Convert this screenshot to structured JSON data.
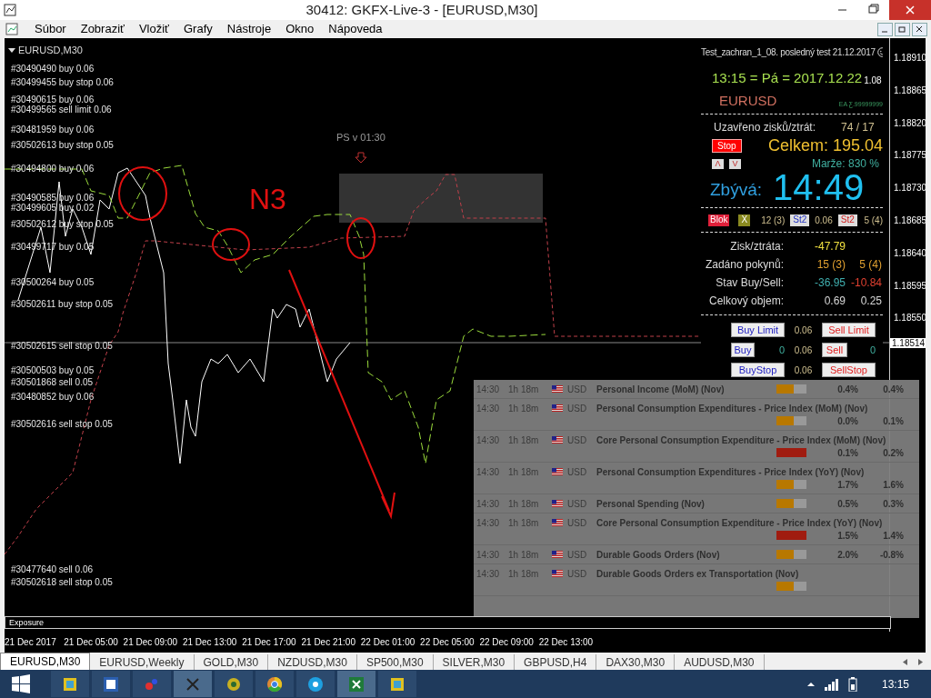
{
  "window": {
    "title": "30412: GKFX-Live-3 - [EURUSD,M30]"
  },
  "menu": [
    "Súbor",
    "Zobraziť",
    "Vložiť",
    "Grafy",
    "Nástroje",
    "Okno",
    "Nápoveda"
  ],
  "chart": {
    "symbol": "EURUSD,M30",
    "annotation": "N3",
    "event_label": "PS v 01:30",
    "order_labels": [
      "#30490490 buy 0.06",
      "#30499455 buy stop 0.06",
      "#30490615 buy 0.06",
      "#30499565 sell limit 0.06",
      "#30481959 buy 0.06",
      "#30502613 buy stop 0.05",
      "#30494800 buy 0.06",
      "#30490585 buy 0.06",
      "#30499605 buy 0.02",
      "#30502612 buy stop 0.05",
      "#30499717 buy 0.05",
      "#30500264 buy 0.05",
      "#30502611 buy stop 0.05",
      "#30502615 sell stop 0.05",
      "#30500503 buy 0.05",
      "#30501868 sell 0.05",
      "#30480852 buy 0.06",
      "#30502616 sell stop 0.05",
      "#30477640 sell 0.06",
      "#30502618 sell stop 0.05"
    ],
    "price_axis": [
      "1.18910",
      "1.18865",
      "1.18820",
      "1.18775",
      "1.18730",
      "1.18685",
      "1.18640",
      "1.18595",
      "1.18550"
    ],
    "current_price": "1.18514",
    "exposure_label": "Exposure"
  },
  "time_axis": [
    "21 Dec 2017",
    "21 Dec 05:00",
    "21 Dec 09:00",
    "21 Dec 13:00",
    "21 Dec 17:00",
    "21 Dec 21:00",
    "22 Dec 01:00",
    "22 Dec 05:00",
    "22 Dec 09:00",
    "22 Dec 13:00"
  ],
  "panel": {
    "title": "Test_zachran_1_08. posledný test 21.12.2017",
    "clock": "13:15 = Pá = 2017.12.22",
    "clock_suffix": "1.08",
    "symbol": "EURUSD",
    "ea_tag": "EA Ƹ.99999999",
    "closed_label": "Uzavřeno zisků/ztrát:",
    "closed_value": "74 / 17",
    "stop_button": "Stop",
    "total": "Celkem: 195.04",
    "arrow_buttons": [
      "Λ",
      "V"
    ],
    "margin": "Marže: 830 %",
    "remaining_label": "Zbývá:",
    "remaining": "14:49",
    "blok_button": "Blok",
    "x_button": "X",
    "buy_count": "12 (3)",
    "st2_buy_button": "St2",
    "lot": "0.06",
    "st2_sell_button": "St2",
    "sell_count": "5 (4)",
    "stats": [
      {
        "label": "Zisk/ztráta:",
        "values": [
          {
            "text": "-47.79",
            "color": "#f0e040"
          }
        ]
      },
      {
        "label": "Zadáno pokynů:",
        "values": [
          {
            "text": "15 (3)",
            "color": "#e0a030"
          },
          {
            "text": "5 (4)",
            "color": "#e0a030"
          }
        ]
      },
      {
        "label": "Stav Buy/Sell:",
        "values": [
          {
            "text": "-36.95",
            "color": "#40b0b0"
          },
          {
            "text": "-10.84",
            "color": "#e04030"
          }
        ]
      },
      {
        "label": "Celkový objem:",
        "values": [
          {
            "text": "0.69",
            "color": "#d8d8d8"
          },
          {
            "text": "0.25",
            "color": "#d8d8d8"
          }
        ]
      }
    ],
    "order_rows": [
      {
        "buy": "Buy Limit",
        "lot": "0.06",
        "sell": "Sell Limit"
      },
      {
        "buy": "Buy",
        "buy_count": "0",
        "lot": "0.06",
        "sell": "Sell",
        "sell_count": "0"
      },
      {
        "buy": "BuyStop",
        "lot": "0.06",
        "sell": "SellStop"
      }
    ]
  },
  "news": [
    {
      "time": "14:30",
      "countdown": "1h 18m",
      "currency": "USD",
      "event": "Personal Income (MoM) (Nov)",
      "level": 0.58,
      "color": "#b87800",
      "forecast": "0.4%",
      "previous": "0.4%"
    },
    {
      "time": "14:30",
      "countdown": "1h 18m",
      "currency": "USD",
      "event": "Personal Consumption Expenditures - Price Index (MoM) (Nov)",
      "level": 0.58,
      "color": "#b87800",
      "forecast": "0.0%",
      "previous": "0.1%"
    },
    {
      "time": "14:30",
      "countdown": "1h 18m",
      "currency": "USD",
      "event": "Core Personal Consumption Expenditure - Price Index (MoM) (Nov)",
      "level": 1,
      "color": "#a01c10",
      "forecast": "0.1%",
      "previous": "0.2%"
    },
    {
      "time": "14:30",
      "countdown": "1h 18m",
      "currency": "USD",
      "event": "Personal Consumption Expenditures - Price Index (YoY) (Nov)",
      "level": 0.58,
      "color": "#b87800",
      "forecast": "1.7%",
      "previous": "1.6%"
    },
    {
      "time": "14:30",
      "countdown": "1h 18m",
      "currency": "USD",
      "event": "Personal Spending (Nov)",
      "level": 0.58,
      "color": "#b87800",
      "forecast": "0.5%",
      "previous": "0.3%"
    },
    {
      "time": "14:30",
      "countdown": "1h 18m",
      "currency": "USD",
      "event": "Core Personal Consumption Expenditure - Price Index (YoY) (Nov)",
      "level": 1,
      "color": "#a01c10",
      "forecast": "1.5%",
      "previous": "1.4%"
    },
    {
      "time": "14:30",
      "countdown": "1h 18m",
      "currency": "USD",
      "event": "Durable Goods Orders (Nov)",
      "level": 0.58,
      "color": "#b87800",
      "forecast": "2.0%",
      "previous": "-0.8%"
    },
    {
      "time": "14:30",
      "countdown": "1h 18m",
      "currency": "USD",
      "event": "Durable Goods Orders ex Transportation (Nov)",
      "level": 0.58,
      "color": "#b87800"
    }
  ],
  "tabs": [
    {
      "label": "EURUSD,M30",
      "selected": true
    },
    {
      "label": "EURUSD,Weekly",
      "selected": false
    },
    {
      "label": "GOLD,M30",
      "selected": false
    },
    {
      "label": "NZDUSD,M30",
      "selected": false
    },
    {
      "label": "SP500,M30",
      "selected": false
    },
    {
      "label": "SILVER,M30",
      "selected": false
    },
    {
      "label": "GBPUSD,H4",
      "selected": false
    },
    {
      "label": "DAX30,M30",
      "selected": false
    },
    {
      "label": "AUDUSD,M30",
      "selected": false
    }
  ],
  "taskbar": {
    "apps": [
      {
        "kind": "generic",
        "active": false
      },
      {
        "kind": "word",
        "active": false
      },
      {
        "kind": "dots",
        "active": false
      },
      {
        "kind": "terminal",
        "active": true
      },
      {
        "kind": "globe",
        "active": false
      },
      {
        "kind": "chrome",
        "active": false
      },
      {
        "kind": "skype",
        "active": false
      },
      {
        "kind": "excel",
        "active": true
      },
      {
        "kind": "generic",
        "active": false
      }
    ],
    "clock": "13:15"
  }
}
